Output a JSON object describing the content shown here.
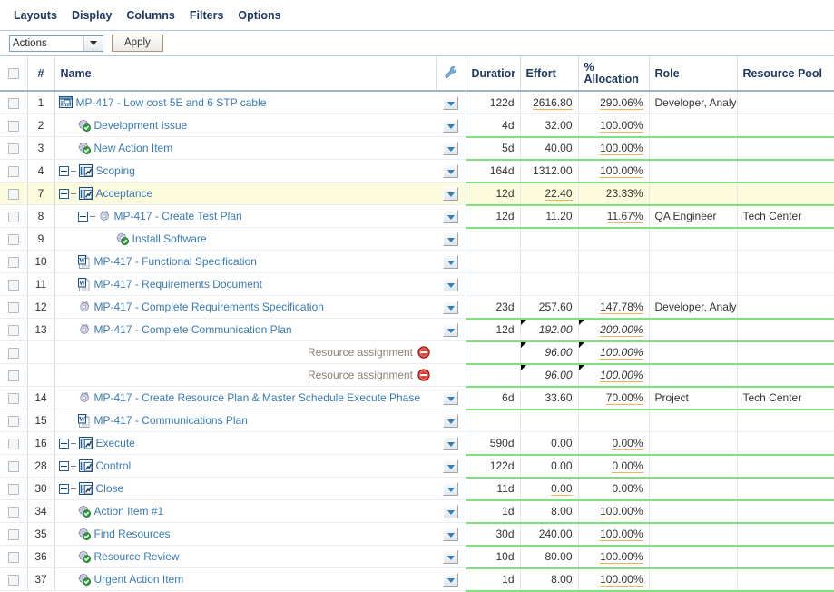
{
  "menu": {
    "items": [
      {
        "label": "Layouts",
        "name": "menu-layouts"
      },
      {
        "label": "Display",
        "name": "menu-display"
      },
      {
        "label": "Columns",
        "name": "menu-columns"
      },
      {
        "label": "Filters",
        "name": "menu-filters"
      },
      {
        "label": "Options",
        "name": "menu-options"
      }
    ]
  },
  "actionbar": {
    "select_value": "Actions",
    "apply_label": "Apply"
  },
  "colors": {
    "link": "#3a7ab5",
    "header_text": "#1f3864",
    "selected_row": "#fcfbdd",
    "green_separator": "#7fe07f",
    "orange_underline": "#f0b35b",
    "grey_text": "#8d8273"
  },
  "columns": [
    {
      "key": "checkbox",
      "label": "",
      "name": "column-select-all"
    },
    {
      "key": "num",
      "label": "#",
      "name": "column-number"
    },
    {
      "key": "name",
      "label": "Name",
      "name": "column-name"
    },
    {
      "key": "wrench",
      "label": "",
      "name": "column-actions"
    },
    {
      "key": "duration",
      "label": "Duratior",
      "name": "column-duration"
    },
    {
      "key": "effort",
      "label": "Effort",
      "name": "column-effort"
    },
    {
      "key": "allocation",
      "label": "% Allocation",
      "label_line1": "%",
      "label_line2": "Allocation",
      "name": "column-allocation"
    },
    {
      "key": "role",
      "label": "Role",
      "name": "column-role"
    },
    {
      "key": "pool",
      "label": "Resource Pool",
      "name": "column-resource-pool"
    }
  ],
  "rows": [
    {
      "num": "1",
      "indent": 0,
      "expander": "",
      "icon": "project-icon",
      "name": "MP-417 - Low cost 5E and 6 STP cable",
      "duration": "122d",
      "effort": "2616.80",
      "effort_u": true,
      "alloc": "290.06%",
      "alloc_u": true,
      "role": "Developer, Analy",
      "pool": "",
      "selected": false,
      "italic": false,
      "corner": false,
      "greenline": false,
      "dropdown": true
    },
    {
      "num": "2",
      "indent": 1,
      "expander": "",
      "icon": "gear-check-icon",
      "name": "Development Issue",
      "duration": "4d",
      "effort": "32.00",
      "effort_u": false,
      "alloc": "100.00%",
      "alloc_u": true,
      "role": "",
      "pool": "",
      "selected": false,
      "italic": false,
      "corner": false,
      "greenline": true,
      "dropdown": true
    },
    {
      "num": "3",
      "indent": 1,
      "expander": "",
      "icon": "gear-check-icon",
      "name": "New Action Item",
      "duration": "5d",
      "effort": "40.00",
      "effort_u": false,
      "alloc": "100.00%",
      "alloc_u": true,
      "role": "",
      "pool": "",
      "selected": false,
      "italic": false,
      "corner": false,
      "greenline": true,
      "dropdown": true
    },
    {
      "num": "4",
      "indent": 0,
      "expander": "plus",
      "icon": "chart-icon",
      "name": "Scoping",
      "duration": "164d",
      "effort": "1312.00",
      "effort_u": false,
      "alloc": "100.00%",
      "alloc_u": true,
      "role": "",
      "pool": "",
      "selected": false,
      "italic": false,
      "corner": false,
      "greenline": true,
      "dropdown": true
    },
    {
      "num": "7",
      "indent": 0,
      "expander": "minus",
      "icon": "chart-icon",
      "name": "Acceptance",
      "duration": "12d",
      "effort": "22.40",
      "effort_u": true,
      "alloc": "23.33%",
      "alloc_u": false,
      "role": "",
      "pool": "",
      "selected": true,
      "italic": false,
      "corner": false,
      "greenline": true,
      "dropdown": true
    },
    {
      "num": "8",
      "indent": 1,
      "expander": "minus",
      "icon": "gear-icon",
      "name": "MP-417 - Create Test Plan",
      "duration": "12d",
      "effort": "11.20",
      "effort_u": false,
      "alloc": "11.67%",
      "alloc_u": true,
      "role": "QA Engineer",
      "pool": "Tech Center",
      "selected": false,
      "italic": false,
      "corner": false,
      "greenline": true,
      "dropdown": true
    },
    {
      "num": "9",
      "indent": 3,
      "expander": "",
      "icon": "gear-check-icon",
      "name": "Install Software",
      "duration": "",
      "effort": "",
      "effort_u": false,
      "alloc": "",
      "alloc_u": false,
      "role": "",
      "pool": "",
      "selected": false,
      "italic": false,
      "corner": false,
      "greenline": false,
      "dropdown": true
    },
    {
      "num": "10",
      "indent": 1,
      "expander": "",
      "icon": "word-doc-icon",
      "name": "MP-417 - Functional Specification",
      "duration": "",
      "effort": "",
      "effort_u": false,
      "alloc": "",
      "alloc_u": false,
      "role": "",
      "pool": "",
      "selected": false,
      "italic": false,
      "corner": false,
      "greenline": false,
      "dropdown": true
    },
    {
      "num": "11",
      "indent": 1,
      "expander": "",
      "icon": "word-doc-icon",
      "name": "MP-417 - Requirements Document",
      "duration": "",
      "effort": "",
      "effort_u": false,
      "alloc": "",
      "alloc_u": false,
      "role": "",
      "pool": "",
      "selected": false,
      "italic": false,
      "corner": false,
      "greenline": false,
      "dropdown": true
    },
    {
      "num": "12",
      "indent": 1,
      "expander": "",
      "icon": "gear-icon",
      "name": "MP-417 - Complete Requirements Specification",
      "duration": "23d",
      "effort": "257.60",
      "effort_u": false,
      "alloc": "147.78%",
      "alloc_u": true,
      "role": "Developer, Analy",
      "pool": "",
      "selected": false,
      "italic": false,
      "corner": false,
      "greenline": true,
      "dropdown": true
    },
    {
      "num": "13",
      "indent": 1,
      "expander": "",
      "icon": "gear-icon",
      "name": "MP-417 - Complete Communication Plan",
      "duration": "12d",
      "effort": "192.00",
      "effort_u": false,
      "alloc": "200.00%",
      "alloc_u": true,
      "role": "",
      "pool": "",
      "selected": false,
      "italic": true,
      "corner": true,
      "greenline": true,
      "dropdown": true
    },
    {
      "num": "",
      "indent": 0,
      "expander": "",
      "icon": "deny-icon",
      "name": "Resource assignment",
      "resource_assignment": true,
      "duration": "",
      "effort": "96.00",
      "effort_u": false,
      "alloc": "100.00%",
      "alloc_u": true,
      "role": "",
      "pool": "",
      "selected": false,
      "italic": true,
      "corner": true,
      "greenline": true,
      "dropdown": false
    },
    {
      "num": "",
      "indent": 0,
      "expander": "",
      "icon": "deny-icon",
      "name": "Resource assignment",
      "resource_assignment": true,
      "duration": "",
      "effort": "96.00",
      "effort_u": false,
      "alloc": "100.00%",
      "alloc_u": true,
      "role": "",
      "pool": "",
      "selected": false,
      "italic": true,
      "corner": true,
      "greenline": true,
      "dropdown": false
    },
    {
      "num": "14",
      "indent": 1,
      "expander": "",
      "icon": "gear-icon",
      "name": "MP-417 - Create Resource Plan & Master Schedule Execute Phase",
      "duration": "6d",
      "effort": "33.60",
      "effort_u": false,
      "alloc": "70.00%",
      "alloc_u": true,
      "role": "Project",
      "pool": "Tech Center",
      "selected": false,
      "italic": false,
      "corner": false,
      "greenline": true,
      "dropdown": true
    },
    {
      "num": "15",
      "indent": 1,
      "expander": "",
      "icon": "word-doc-icon",
      "name": "MP-417 - Communications Plan",
      "duration": "",
      "effort": "",
      "effort_u": false,
      "alloc": "",
      "alloc_u": false,
      "role": "",
      "pool": "",
      "selected": false,
      "italic": false,
      "corner": false,
      "greenline": false,
      "dropdown": true
    },
    {
      "num": "16",
      "indent": 0,
      "expander": "plus",
      "icon": "chart-icon",
      "name": "Execute",
      "duration": "590d",
      "effort": "0.00",
      "effort_u": false,
      "alloc": "0.00%",
      "alloc_u": true,
      "role": "",
      "pool": "",
      "selected": false,
      "italic": false,
      "corner": false,
      "greenline": true,
      "dropdown": true
    },
    {
      "num": "28",
      "indent": 0,
      "expander": "plus",
      "icon": "chart-icon",
      "name": "Control",
      "duration": "122d",
      "effort": "0.00",
      "effort_u": false,
      "alloc": "0.00%",
      "alloc_u": true,
      "role": "",
      "pool": "",
      "selected": false,
      "italic": false,
      "corner": false,
      "greenline": true,
      "dropdown": true
    },
    {
      "num": "30",
      "indent": 0,
      "expander": "plus",
      "icon": "chart-icon",
      "name": "Close",
      "duration": "11d",
      "effort": "0.00",
      "effort_u": true,
      "alloc": "0.00%",
      "alloc_u": false,
      "role": "",
      "pool": "",
      "selected": false,
      "italic": false,
      "corner": false,
      "greenline": true,
      "dropdown": true
    },
    {
      "num": "34",
      "indent": 1,
      "expander": "",
      "icon": "gear-check-icon",
      "name": "Action Item #1",
      "duration": "1d",
      "effort": "8.00",
      "effort_u": false,
      "alloc": "100.00%",
      "alloc_u": true,
      "role": "",
      "pool": "",
      "selected": false,
      "italic": false,
      "corner": false,
      "greenline": true,
      "dropdown": true
    },
    {
      "num": "35",
      "indent": 1,
      "expander": "",
      "icon": "gear-check-icon",
      "name": "Find Resources",
      "duration": "30d",
      "effort": "240.00",
      "effort_u": false,
      "alloc": "100.00%",
      "alloc_u": true,
      "role": "",
      "pool": "",
      "selected": false,
      "italic": false,
      "corner": false,
      "greenline": true,
      "dropdown": true
    },
    {
      "num": "36",
      "indent": 1,
      "expander": "",
      "icon": "gear-check-icon",
      "name": "Resource Review",
      "duration": "10d",
      "effort": "80.00",
      "effort_u": false,
      "alloc": "100.00%",
      "alloc_u": true,
      "role": "",
      "pool": "",
      "selected": false,
      "italic": false,
      "corner": false,
      "greenline": true,
      "dropdown": true
    },
    {
      "num": "37",
      "indent": 1,
      "expander": "",
      "icon": "gear-check-icon",
      "name": "Urgent Action Item",
      "duration": "1d",
      "effort": "8.00",
      "effort_u": false,
      "alloc": "100.00%",
      "alloc_u": true,
      "role": "",
      "pool": "",
      "selected": false,
      "italic": false,
      "corner": false,
      "greenline": true,
      "dropdown": true
    }
  ]
}
